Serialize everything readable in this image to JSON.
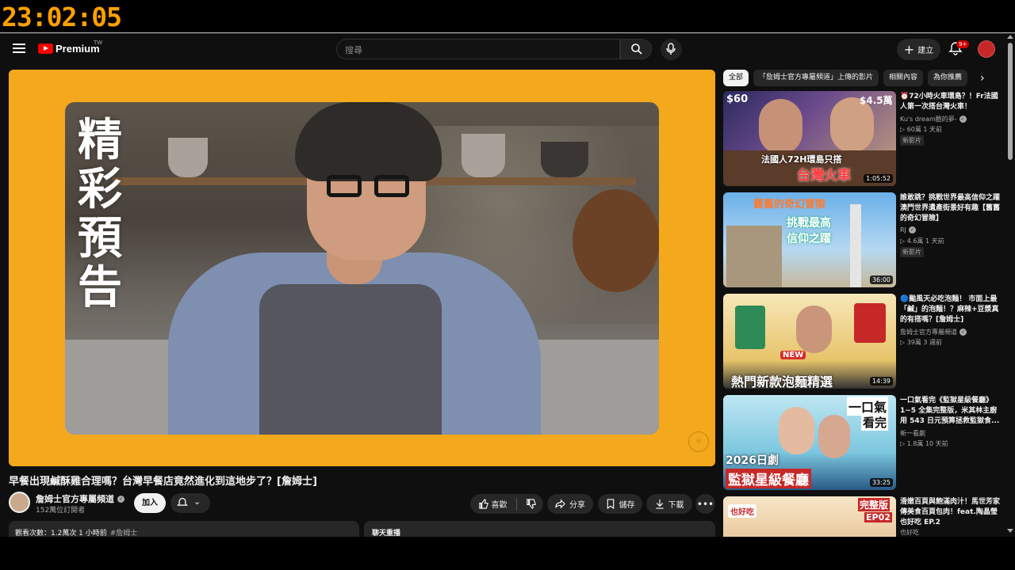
{
  "overlay": {
    "clock": "23:02:05"
  },
  "masthead": {
    "logo_text": "Premium",
    "region": "TW",
    "search_placeholder": "搜尋",
    "create_label": "建立",
    "notifications_badge": "9+"
  },
  "player": {
    "promo_text": "精彩預告"
  },
  "video": {
    "title": "早餐出現鹹酥雞合理嗎？台灣早餐店竟然進化到這地步了？[詹姆士]",
    "channel": "詹姆士官方專屬頻道",
    "subscribers": "152萬位訂閱者",
    "join_label": "加入",
    "like_label": "喜歡",
    "share_label": "分享",
    "save_label": "儲存",
    "download_label": "下載",
    "description_stats": "觀看次數：1.2萬次  1 小時前",
    "description_tag": "#詹姆士",
    "chat_label": "聊天重播"
  },
  "chips": [
    {
      "label": "全部",
      "active": true
    },
    {
      "label": "「詹姆士官方專屬頻道」上傳的影片"
    },
    {
      "label": "相關內容"
    },
    {
      "label": "為你推薦"
    }
  ],
  "recommendations": [
    {
      "title": "⏰72小時火車環島？！Fr法國人第一次搭台灣火車！",
      "channel": "Ku's dream酷的夢-",
      "meta": "▷ 60萬  1 天前",
      "badge": "新影片",
      "duration": "1:05:52",
      "thumb_texts": [
        "$60",
        "$4.5萬",
        "法國人72H環島只搭",
        "台灣火車"
      ]
    },
    {
      "title": "誰敢跳？挑戰世界最高信仰之躍 澳門世界遺產街景好有趣【舊舊的奇幻冒險】",
      "channel": "RJ",
      "meta": "▷ 4.6萬  1 天前",
      "badge": "新影片",
      "duration": "36:00",
      "thumb_texts": [
        "舊舊的奇幻冒險",
        "挑戰最高",
        "信仰之躍"
      ]
    },
    {
      "title": "🔵颱風天必吃泡麵！ 市面上最「鹹」的泡麵！？麻辣+豆漿真的有搭嗎？[詹姆士]",
      "channel": "詹姆士官方專屬頻道",
      "meta": "▷ 39萬  3 週前",
      "badge": "",
      "duration": "14:39",
      "thumb_texts": [
        "NEW",
        "熱門新款泡麵精選"
      ]
    },
    {
      "title": "一口氣看完《監獄星級餐廳》1~5 全集完整版，米其林主廚用 543 日元預算拯救監獄食...",
      "channel": "新一看劇",
      "meta": "▷ 1.8萬  10 天前",
      "badge": "",
      "duration": "33:25",
      "thumb_texts": [
        "一口氣",
        "看完",
        "2026日劇",
        "監獄星級餐廳"
      ]
    },
    {
      "title": "滑嫩百頁與飽滿肉汁！馬世芳家傳美食百頁包肉！feat.陶晶瑩 也好吃 EP.2",
      "channel": "也好吃",
      "meta": "",
      "badge": "",
      "duration": "",
      "thumb_texts": [
        "也好吃",
        "完整版",
        "EP02"
      ]
    }
  ],
  "colors": {
    "accent": "#ff0000",
    "player_frame": "#f4a81c",
    "clock": "#ffa000",
    "background": "#0f0f0f"
  }
}
